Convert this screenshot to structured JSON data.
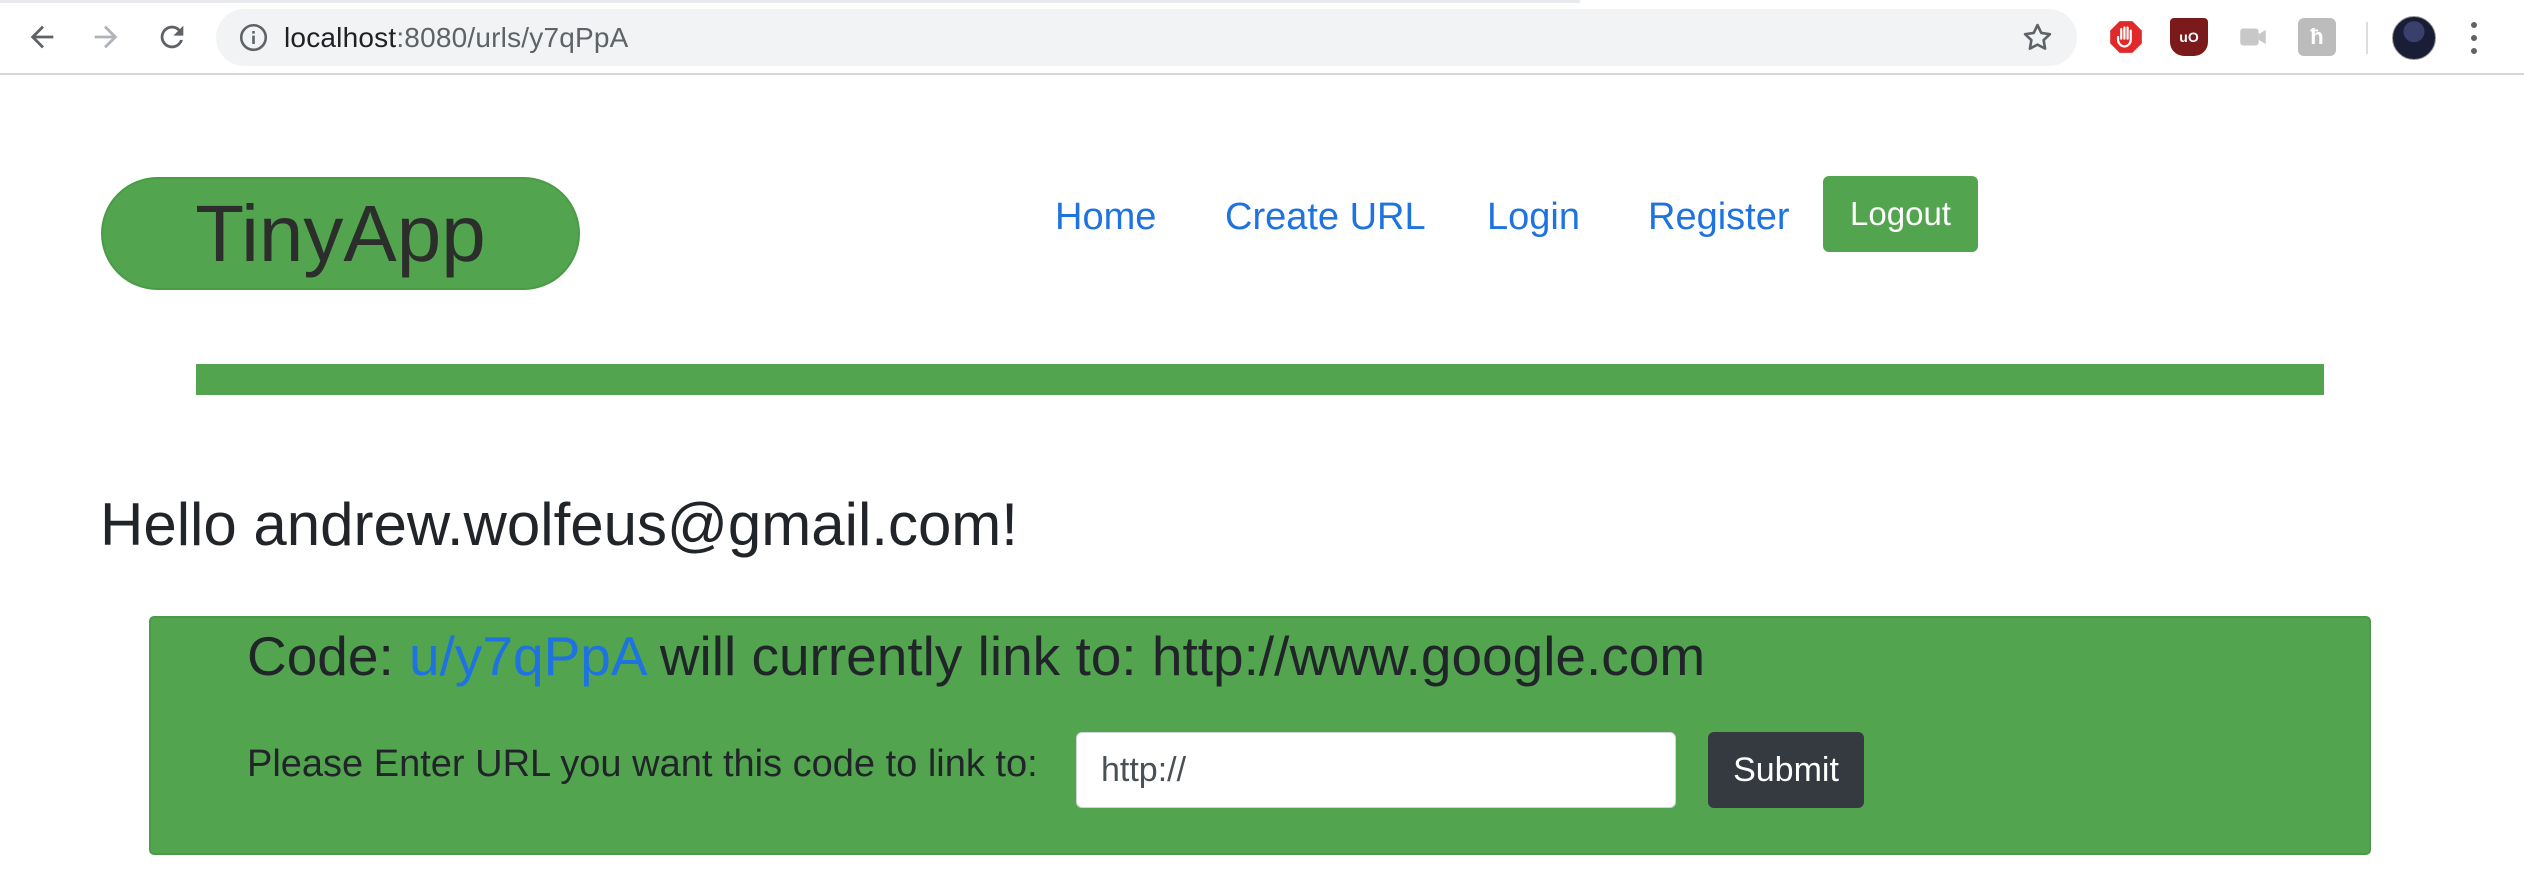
{
  "browser": {
    "url_host": "localhost",
    "url_path": ":8080/urls/y7qPpA",
    "icons": [
      "back-arrow-icon",
      "forward-arrow-icon",
      "reload-icon",
      "info-icon",
      "star-icon",
      "adblock-icon",
      "ublock-icon",
      "camera-extension-icon",
      "h-extension-icon",
      "profile-avatar",
      "kebab-menu-icon"
    ],
    "ext_labels": {
      "ublock": "uO",
      "h": "ħ"
    }
  },
  "header": {
    "brand": "TinyApp",
    "nav": [
      {
        "label": "Home"
      },
      {
        "label": "Create URL"
      },
      {
        "label": "Login"
      },
      {
        "label": "Register"
      }
    ],
    "logout_label": "Logout"
  },
  "main": {
    "greeting": "Hello andrew.wolfeus@gmail.com!",
    "code_prefix": "Code: ",
    "short_code": "u/y7qPpA",
    "link_text": " will currently link to: http://www.google.com",
    "input_label": "Please Enter URL you want this code to link to:",
    "input_value": "http://",
    "submit_label": "Submit"
  },
  "colors": {
    "accent_green": "#52a54e",
    "link_blue": "#1f73e0",
    "dark_button": "#343a40"
  }
}
